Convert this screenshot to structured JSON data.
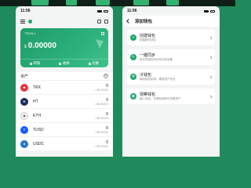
{
  "left_phone": {
    "status_time": "11:56",
    "wallet_name": "TRON-1",
    "balance_currency": "$",
    "balance_amount": "0.00000",
    "actions": [
      {
        "label": "转账",
        "icon": "transfer-icon"
      },
      {
        "label": "收款",
        "icon": "receive-icon"
      },
      {
        "label": "兑换",
        "icon": "exchange-icon"
      }
    ],
    "assets_title": "资产",
    "assets": [
      {
        "symbol": "TRX",
        "amount": "0",
        "usd": "≈ $0.00000",
        "color": "#e8323e",
        "glyph": "◆"
      },
      {
        "symbol": "HT",
        "amount": "0",
        "usd": "≈ $0.00000",
        "color": "#1c2c5a",
        "glyph": "H"
      },
      {
        "symbol": "ETH",
        "amount": "0",
        "usd": "≈ $0.00000",
        "color": "#ffffff",
        "glyph": "◆"
      },
      {
        "symbol": "TUSD",
        "amount": "0",
        "usd": "≈ $0.00000",
        "color": "#1a5aff",
        "glyph": "T"
      },
      {
        "symbol": "USDC",
        "amount": "0",
        "usd": "≈ $0.00000",
        "color": "#2775ca",
        "glyph": "$"
      }
    ]
  },
  "right_phone": {
    "status_time": "11:56",
    "title": "添加钱包",
    "options": [
      {
        "title": "创建钱包",
        "desc": "创建新的钱包",
        "icon": "+"
      },
      {
        "title": "一键同步",
        "desc": "将已有钱包同步到当前设备",
        "icon": "↻"
      },
      {
        "title": "冷钱包",
        "desc": "离线保存私钥，确保资产安全",
        "icon": "❄"
      },
      {
        "title": "观察钱包",
        "desc": "输入地址，无需私钥即可查看资产",
        "icon": "◉"
      }
    ]
  },
  "colors": {
    "background": "#1f8a5b",
    "accent": "#1fa36b"
  }
}
